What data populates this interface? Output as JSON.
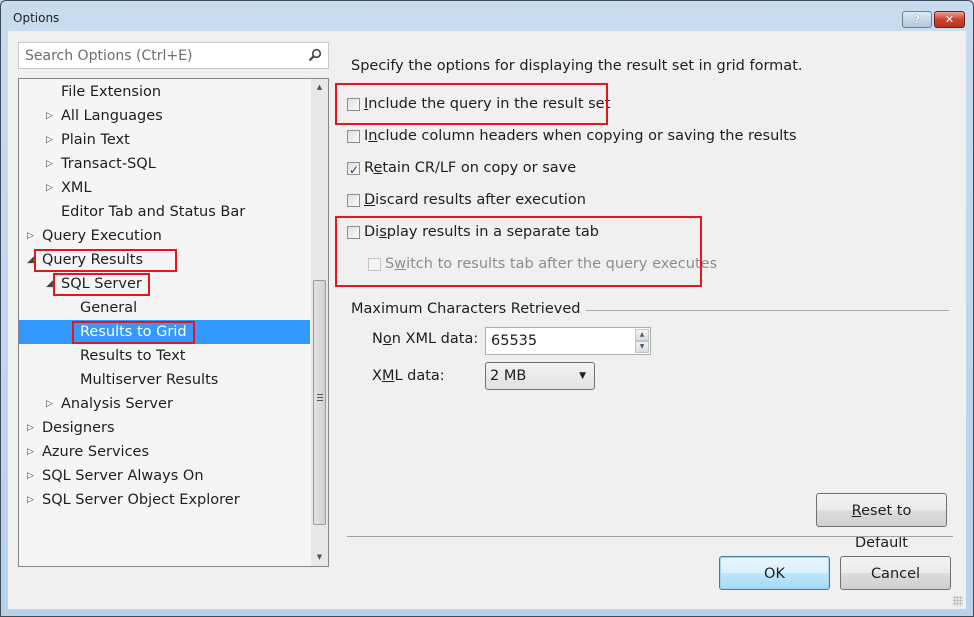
{
  "window": {
    "title": "Options",
    "help_button": "?",
    "close_button": "✕"
  },
  "search": {
    "placeholder": "Search Options (Ctrl+E)",
    "value": "",
    "icon": "search-icon"
  },
  "tree": {
    "items": [
      {
        "label": "File Extension",
        "level": 2,
        "arrow": "",
        "expanded": false
      },
      {
        "label": "All Languages",
        "level": 2,
        "arrow": "▷",
        "expanded": false
      },
      {
        "label": "Plain Text",
        "level": 2,
        "arrow": "▷",
        "expanded": false
      },
      {
        "label": "Transact-SQL",
        "level": 2,
        "arrow": "▷",
        "expanded": false
      },
      {
        "label": "XML",
        "level": 2,
        "arrow": "▷",
        "expanded": false
      },
      {
        "label": "Editor Tab and Status Bar",
        "level": 2,
        "arrow": "",
        "expanded": false
      },
      {
        "label": "Query Execution",
        "level": 1,
        "arrow": "▷",
        "expanded": false
      },
      {
        "label": "Query Results",
        "level": 1,
        "arrow": "◢",
        "expanded": true,
        "highlighted": true
      },
      {
        "label": "SQL Server",
        "level": 2,
        "arrow": "◢",
        "expanded": true,
        "highlighted": true
      },
      {
        "label": "General",
        "level": 3,
        "arrow": ""
      },
      {
        "label": "Results to Grid",
        "level": 3,
        "arrow": "",
        "selected": true,
        "highlighted": true
      },
      {
        "label": "Results to Text",
        "level": 3,
        "arrow": ""
      },
      {
        "label": "Multiserver Results",
        "level": 3,
        "arrow": ""
      },
      {
        "label": "Analysis Server",
        "level": 2,
        "arrow": "▷",
        "expanded": false
      },
      {
        "label": "Designers",
        "level": 1,
        "arrow": "▷",
        "expanded": false
      },
      {
        "label": "Azure Services",
        "level": 1,
        "arrow": "▷",
        "expanded": false
      },
      {
        "label": "SQL Server Always On",
        "level": 1,
        "arrow": "▷",
        "expanded": false
      },
      {
        "label": "SQL Server Object Explorer",
        "level": 1,
        "arrow": "▷",
        "expanded": false
      }
    ]
  },
  "panel": {
    "description": "Specify the options for displaying the result set in grid format.",
    "options": [
      {
        "pre": "",
        "acc": "I",
        "post": "nclude the query in the result set",
        "checked": false,
        "enabled": true
      },
      {
        "pre": "I",
        "acc": "n",
        "post": "clude column headers when copying or saving the results",
        "checked": false,
        "enabled": true
      },
      {
        "pre": "R",
        "acc": "e",
        "post": "tain CR/LF on copy or save",
        "checked": true,
        "enabled": true
      },
      {
        "pre": "",
        "acc": "D",
        "post": "iscard results after execution",
        "checked": false,
        "enabled": true
      },
      {
        "pre": "Di",
        "acc": "s",
        "post": "play results in a separate tab",
        "checked": false,
        "enabled": true
      },
      {
        "pre": "S",
        "acc": "w",
        "post": "itch to results tab after the query executes",
        "checked": false,
        "enabled": false
      }
    ],
    "group_title": "Maximum Characters Retrieved",
    "non_xml": {
      "pre": "N",
      "acc": "o",
      "post": "n XML data:",
      "value": "65535"
    },
    "xml": {
      "pre": "X",
      "acc": "M",
      "post": "L data:",
      "value": "2 MB"
    }
  },
  "buttons": {
    "reset": {
      "acc": "R",
      "post": "eset to Default"
    },
    "ok": "OK",
    "cancel": "Cancel"
  },
  "colors": {
    "selection": "#3399ff",
    "annotation_red": "#e8141b"
  }
}
